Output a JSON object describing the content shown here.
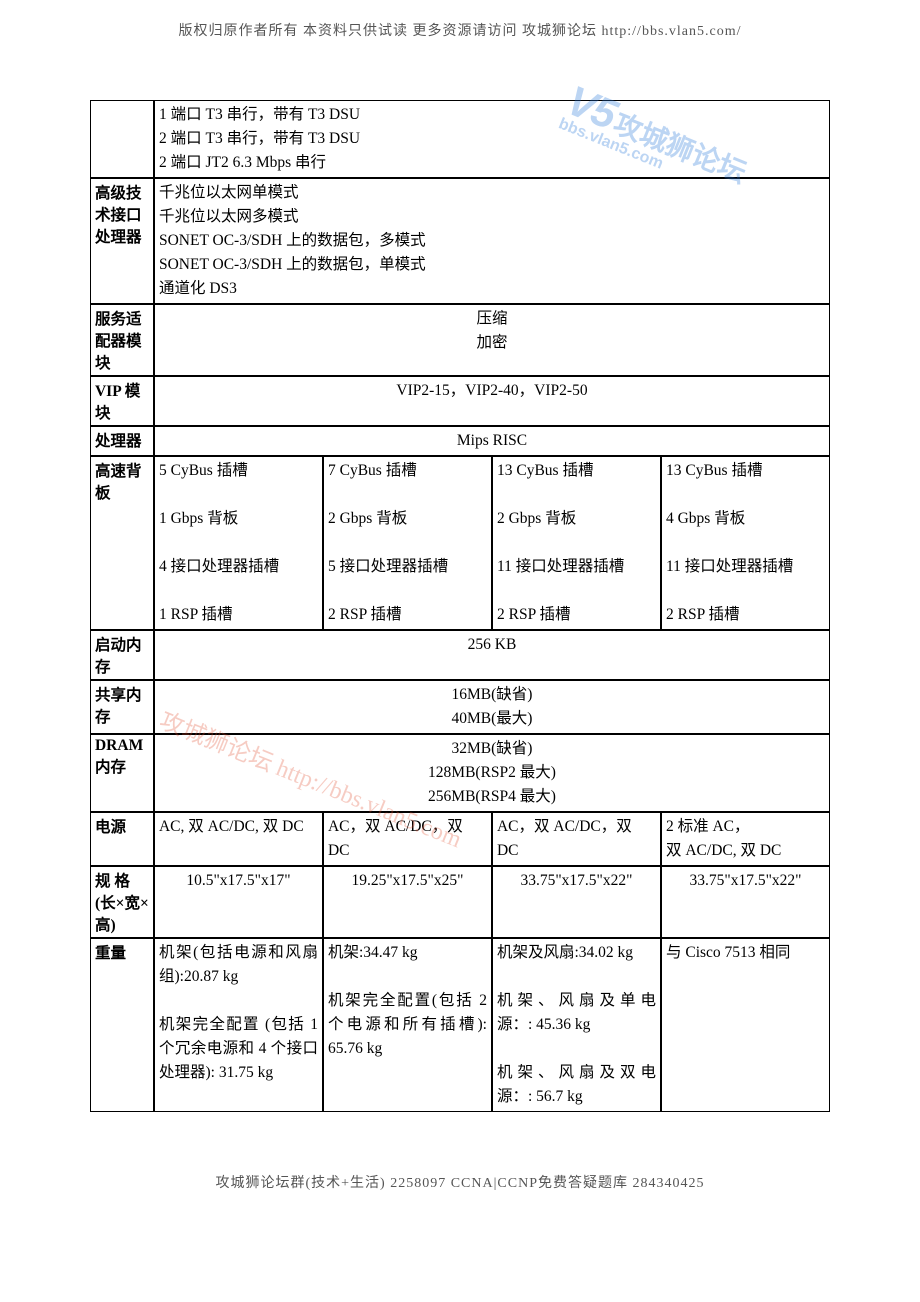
{
  "header": "版权归原作者所有 本资料只供试读 更多资源请访问 攻城狮论坛 http://bbs.vlan5.com/",
  "footer": "攻城狮论坛群(技术+生活) 2258097 CCNA|CCNP免费答疑题库 284340425",
  "watermark": {
    "logo_big": "V5",
    "logo_cn": "攻城狮论坛",
    "logo_url": "bbs.vlan5.com",
    "diag_text": "攻城狮论坛 http://bbs.vlan5.com"
  },
  "rows": {
    "r0_label": "",
    "r0_lines": [
      "1 端口 T3 串行，带有 T3 DSU",
      "2 端口 T3 串行，带有 T3 DSU",
      "2 端口 JT2 6.3 Mbps 串行"
    ],
    "r1_label": "高级技术接口处理器",
    "r1_lines": [
      "千兆位以太网单模式",
      "千兆位以太网多模式",
      "SONET OC-3/SDH 上的数据包，多模式",
      "SONET OC-3/SDH 上的数据包，单模式",
      "通道化 DS3"
    ],
    "r2_label": "服务适配器模块",
    "r2_lines": [
      "压缩",
      "加密"
    ],
    "r3_label": "VIP 模块",
    "r3_text": "VIP2-15，VIP2-40，VIP2-50",
    "r4_label": "处理器",
    "r4_text": "Mips RISC",
    "r5_label": "高速背板",
    "r5_cols": [
      [
        "5 CyBus 插槽",
        "",
        "1 Gbps 背板",
        "",
        "4 接口处理器插槽",
        "",
        "1 RSP 插槽"
      ],
      [
        "7 CyBus 插槽",
        "",
        "2 Gbps 背板",
        "",
        "5 接口处理器插槽",
        "",
        "2 RSP 插槽"
      ],
      [
        "13 CyBus 插槽",
        "",
        "2 Gbps 背板",
        "",
        "11 接口处理器插槽",
        "",
        "2 RSP 插槽"
      ],
      [
        "13 CyBus 插槽",
        "",
        "4 Gbps 背板",
        "",
        "11 接口处理器插槽",
        "",
        "2 RSP 插槽"
      ]
    ],
    "r6_label": "启动内存",
    "r6_text": "256 KB",
    "r7_label": "共享内存",
    "r7_lines": [
      "16MB(缺省)",
      "40MB(最大)"
    ],
    "r8_label": "DRAM内存",
    "r8_lines": [
      "32MB(缺省)",
      "128MB(RSP2 最大)",
      "256MB(RSP4 最大)"
    ],
    "r9_label": "电源",
    "r9_cols": [
      "AC, 双 AC/DC, 双 DC",
      "AC，双 AC/DC，双 DC",
      "AC，双 AC/DC，双 DC",
      "2 标准 AC，\n双 AC/DC, 双 DC"
    ],
    "r10_label": "规 格(长×宽×高)",
    "r10_cols": [
      "10.5\"x17.5\"x17\"",
      "19.25\"x17.5\"x25\"",
      "33.75\"x17.5\"x22\"",
      "33.75\"x17.5\"x22\""
    ],
    "r11_label": "重量",
    "r11_cols": [
      "机架(包括电源和风扇组):20.87 kg\n\n机架完全配置 (包括 1 个冗余电源和 4 个接口处理器): 31.75 kg",
      "机架:34.47 kg\n\n机架完全配置(包括 2 个电源和所有插槽): 65.76 kg",
      "机架及风扇:34.02 kg\n\n机架、风扇及单电源：: 45.36 kg\n\n机架、风扇及双电源：: 56.7 kg",
      "与 Cisco 7513 相同"
    ]
  }
}
